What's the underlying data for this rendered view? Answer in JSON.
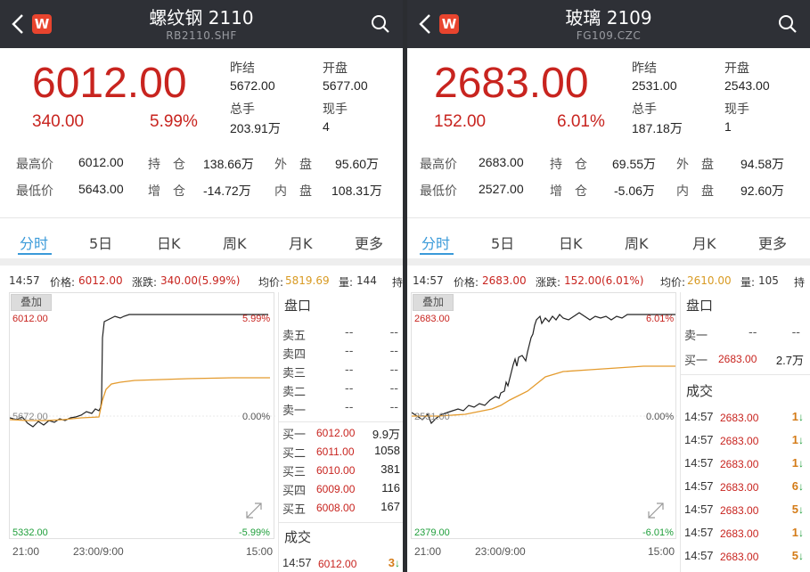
{
  "colors": {
    "up": "#c8241f",
    "down": "#1e9e3a",
    "avg": "#e49b2e",
    "price_line": "#222222",
    "accent": "#3a9ad9",
    "header_bg": "#2e3036"
  },
  "icons": {
    "back": "chevron-left-icon",
    "logo": "w-logo-icon",
    "search": "search-icon",
    "expand": "expand-arrows-icon"
  },
  "tabs": [
    "分时",
    "5日",
    "日K",
    "周K",
    "月K",
    "更多"
  ],
  "labels": {
    "prev_close": "昨结",
    "open": "开盘",
    "total_vol": "总手",
    "cur_vol": "现手",
    "high": "最高价",
    "low": "最低价",
    "oi": "持　仓",
    "oi_chg": "增　仓",
    "outer": "外　盘",
    "inner": "内　盘",
    "price": "价格:",
    "change": "涨跌:",
    "avg": "均价:",
    "vol": "量:",
    "overlay": "叠加",
    "book": "盘口",
    "trades": "成交"
  },
  "left": {
    "title": "螺纹钢 2110",
    "code": "RB2110.SHF",
    "price": "6012.00",
    "change": "340.00",
    "change_pct": "5.99%",
    "prev_close": "5672.00",
    "open": "5677.00",
    "total_vol": "203.91万",
    "cur_vol": "4",
    "high": "6012.00",
    "low": "5643.00",
    "oi": "138.66万",
    "oi_chg": "-14.72万",
    "outer": "95.60万",
    "inner": "108.31万",
    "info_time": "14:57",
    "info_price": "6012.00",
    "info_change": "340.00(5.99%)",
    "info_avg": "5819.69",
    "info_vol": "144",
    "info_cut": "持",
    "chart_top": "6012.00",
    "chart_mid": "5672.00",
    "chart_bottom": "5332.00",
    "pct_top": "5.99%",
    "pct_mid": "0.00%",
    "pct_bottom": "-5.99%",
    "time_start": "21:00",
    "time_mid": "23:00/9:00",
    "time_end": "15:00",
    "asks": [
      {
        "label": "卖五",
        "price": "--",
        "vol": "--"
      },
      {
        "label": "卖四",
        "price": "--",
        "vol": "--"
      },
      {
        "label": "卖三",
        "price": "--",
        "vol": "--"
      },
      {
        "label": "卖二",
        "price": "--",
        "vol": "--"
      },
      {
        "label": "卖一",
        "price": "--",
        "vol": "--"
      }
    ],
    "bids": [
      {
        "label": "买一",
        "price": "6012.00",
        "vol": "9.9万"
      },
      {
        "label": "买二",
        "price": "6011.00",
        "vol": "1058"
      },
      {
        "label": "买三",
        "price": "6010.00",
        "vol": "381"
      },
      {
        "label": "买四",
        "price": "6009.00",
        "vol": "116"
      },
      {
        "label": "买五",
        "price": "6008.00",
        "vol": "167"
      }
    ],
    "trades": [
      {
        "time": "14:57",
        "price": "6012.00",
        "vol": "3"
      }
    ]
  },
  "right": {
    "title": "玻璃 2109",
    "code": "FG109.CZC",
    "price": "2683.00",
    "change": "152.00",
    "change_pct": "6.01%",
    "prev_close": "2531.00",
    "open": "2543.00",
    "total_vol": "187.18万",
    "cur_vol": "1",
    "high": "2683.00",
    "low": "2527.00",
    "oi": "69.55万",
    "oi_chg": "-5.06万",
    "outer": "94.58万",
    "inner": "92.60万",
    "info_time": "14:57",
    "info_price": "2683.00",
    "info_change": "152.00(6.01%)",
    "info_avg": "2610.00",
    "info_vol": "105",
    "info_cut": "持",
    "chart_top": "2683.00",
    "chart_mid": "2531.00",
    "chart_bottom": "2379.00",
    "pct_top": "6.01%",
    "pct_mid": "0.00%",
    "pct_bottom": "-6.01%",
    "time_start": "21:00",
    "time_mid": "23:00/9:00",
    "time_end": "15:00",
    "asks": [
      {
        "label": "卖一",
        "price": "--",
        "vol": "--"
      }
    ],
    "bids": [
      {
        "label": "买一",
        "price": "2683.00",
        "vol": "2.7万"
      }
    ],
    "trades": [
      {
        "time": "14:57",
        "price": "2683.00",
        "vol": "1"
      },
      {
        "time": "14:57",
        "price": "2683.00",
        "vol": "1"
      },
      {
        "time": "14:57",
        "price": "2683.00",
        "vol": "1"
      },
      {
        "time": "14:57",
        "price": "2683.00",
        "vol": "6"
      },
      {
        "time": "14:57",
        "price": "2683.00",
        "vol": "5"
      },
      {
        "time": "14:57",
        "price": "2683.00",
        "vol": "1"
      },
      {
        "time": "14:57",
        "price": "2683.00",
        "vol": "5"
      }
    ]
  }
}
